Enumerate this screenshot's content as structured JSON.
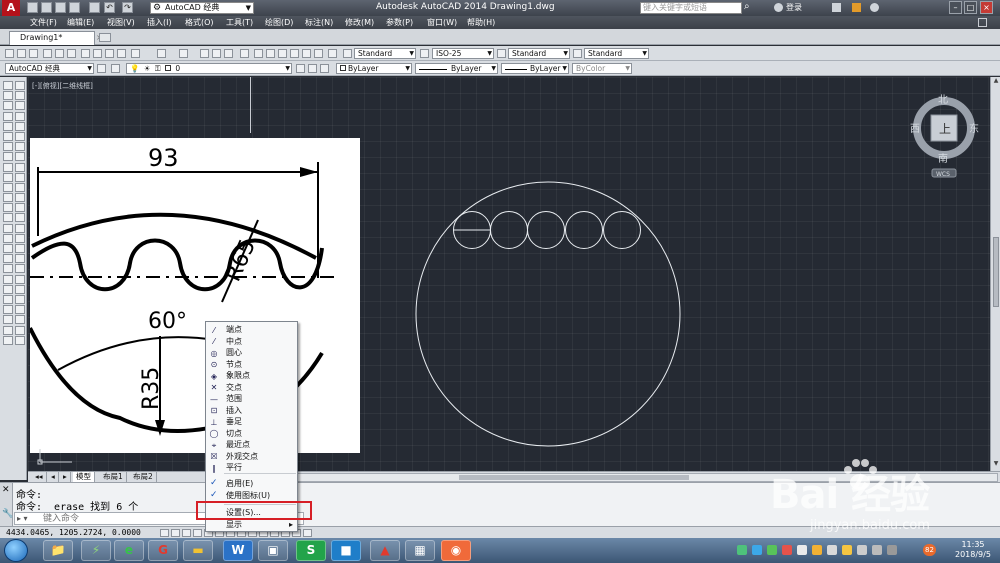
{
  "window": {
    "workspace": "AutoCAD 经典",
    "title": "Autodesk AutoCAD 2014    Drawing1.dwg",
    "search_placeholder": "键入关键字或短语",
    "login": "登录",
    "minimize": "–",
    "maximize": "□",
    "close": "×"
  },
  "menubar": [
    "文件(F)",
    "编辑(E)",
    "视图(V)",
    "插入(I)",
    "格式(O)",
    "工具(T)",
    "绘图(D)",
    "标注(N)",
    "修改(M)",
    "参数(P)",
    "窗口(W)",
    "帮助(H)"
  ],
  "tabs": {
    "document": "Drawing1*",
    "close": "×"
  },
  "toolbar": {
    "text_style": "Standard",
    "dim_style": "ISO-25",
    "table_style": "Standard",
    "multileader_style": "Standard",
    "workspace": "AutoCAD 经典",
    "layer": "0",
    "color": "ByLayer",
    "linetype": "ByLayer",
    "lineweight": "ByLayer",
    "plot_style": "ByColor"
  },
  "viewport": {
    "label": "[-][俯视][二维线框]"
  },
  "viewcube": {
    "north": "北",
    "south": "南",
    "east": "东",
    "west": "西",
    "face": "上",
    "wcs": "WCS"
  },
  "reference_image": {
    "dim_width": "93",
    "dim_r65": "R65",
    "dim_angle": "60°",
    "dim_r35": "R35"
  },
  "layout_tabs": [
    "模型",
    "布局1",
    "布局2"
  ],
  "command": {
    "history": [
      "命令:",
      "命令:  _erase 找到 6 个"
    ],
    "placeholder": "键入命令"
  },
  "status": {
    "coords": "4434.0465, 1205.2724, 0.0000"
  },
  "context_menu": {
    "items": [
      {
        "label": "端点",
        "icon": "⁄"
      },
      {
        "label": "中点",
        "icon": "⁄"
      },
      {
        "label": "圆心",
        "icon": "◎"
      },
      {
        "label": "节点",
        "icon": "⊙"
      },
      {
        "label": "象限点",
        "icon": "◈"
      },
      {
        "label": "交点",
        "icon": "✕"
      },
      {
        "label": "范围",
        "icon": "—"
      },
      {
        "label": "插入",
        "icon": "⊡"
      },
      {
        "label": "垂足",
        "icon": "⊥"
      },
      {
        "label": "切点",
        "icon": "◯"
      },
      {
        "label": "最近点",
        "icon": "⌖"
      },
      {
        "label": "外观交点",
        "icon": "☒"
      },
      {
        "label": "平行",
        "icon": "∥"
      }
    ],
    "enable": "启用(E)",
    "use_icons": "使用图标(U)",
    "settings": "设置(S)...",
    "display": "显示",
    "submenu_arrow": "▸"
  },
  "taskbar": {
    "time": "11:35",
    "date": "2018/9/5",
    "tray_badge": "82"
  },
  "watermark": {
    "brand": "Bai  经验",
    "url": "jingyan.baidu.com"
  }
}
